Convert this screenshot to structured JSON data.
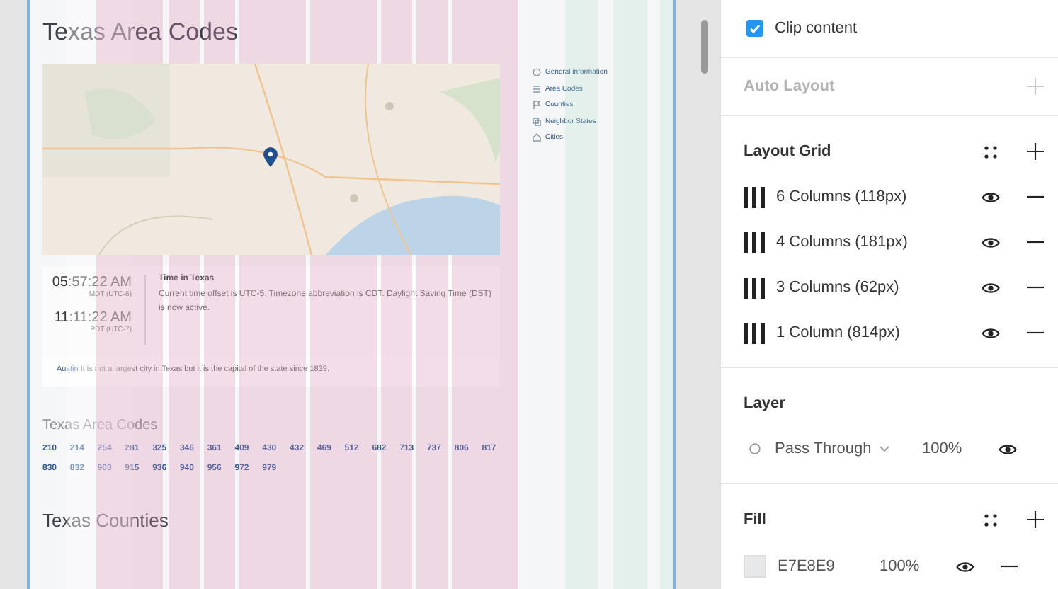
{
  "frame": {
    "title": "Texas Area Codes",
    "nav": [
      {
        "label": "General information"
      },
      {
        "label": "Area Codes"
      },
      {
        "label": "Counties"
      },
      {
        "label": "Neighbor States"
      },
      {
        "label": "Cities"
      }
    ],
    "times": [
      {
        "time": "05:57:22 AM",
        "zone": "MDT (UTC-6)"
      },
      {
        "time": "11:11:22 AM",
        "zone": "PDT (UTC-7)"
      }
    ],
    "time_info": {
      "title": "Time in Texas",
      "text": "Current time offset is UTC-5. Timezone abbreviation is CDT. Daylight Saving Time (DST) is now active."
    },
    "capital_note": {
      "link": "Austin",
      "text": "It is not a largest city in Texas but it is the capital of the state since 1839."
    },
    "area_codes": {
      "heading": "Texas Area Codes",
      "codes": [
        "210",
        "214",
        "254",
        "281",
        "325",
        "346",
        "361",
        "409",
        "430",
        "432",
        "469",
        "512",
        "682",
        "713",
        "737",
        "806",
        "817",
        "830",
        "832",
        "903",
        "915",
        "936",
        "940",
        "956",
        "972",
        "979"
      ]
    },
    "counties_heading": "Texas Counties"
  },
  "panel": {
    "clip_content": {
      "label": "Clip content",
      "checked": true
    },
    "auto_layout": {
      "title": "Auto Layout",
      "disabled": true
    },
    "layout_grid": {
      "title": "Layout Grid",
      "grids": [
        {
          "label": "6 Columns (118px)",
          "visible": true
        },
        {
          "label": "4 Columns (181px)",
          "visible": true
        },
        {
          "label": "3 Columns (62px)",
          "visible": true
        },
        {
          "label": "1 Column (814px)",
          "visible": true
        }
      ]
    },
    "layer": {
      "title": "Layer",
      "blend": "Pass Through",
      "opacity": "100%",
      "visible": true
    },
    "fill": {
      "title": "Fill",
      "fills": [
        {
          "color": "#e7e8e9",
          "hex": "E7E8E9",
          "opacity": "100%",
          "visible": true
        }
      ]
    }
  }
}
